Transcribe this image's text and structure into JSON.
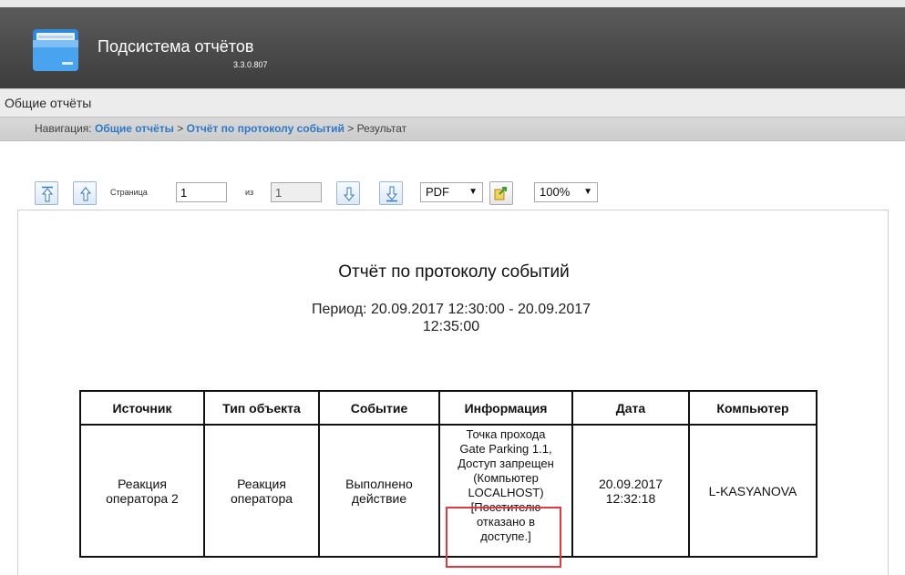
{
  "app": {
    "title": "Подсистема отчётов",
    "version": "3.3.0.807"
  },
  "section": {
    "title": "Общие отчёты"
  },
  "breadcrumb": {
    "prefix": "Навигация:",
    "items": [
      {
        "label": "Общие отчёты"
      },
      {
        "label": "Отчёт по протоколу событий"
      },
      {
        "label": "Результат"
      }
    ],
    "separator": ">"
  },
  "toolbar": {
    "page_label": "Страница",
    "page_value": "1",
    "of_label": "из",
    "total_pages": "1",
    "export_format": "PDF",
    "zoom": "100%"
  },
  "report": {
    "title": "Отчёт по протоколу событий",
    "period_line1": "Период: 20.09.2017 12:30:00 - 20.09.2017",
    "period_line2": "12:35:00",
    "columns": [
      "Источник",
      "Тип объекта",
      "Событие",
      "Информация",
      "Дата",
      "Компьютер"
    ],
    "rows": [
      {
        "source": [
          "Реакция",
          "оператора 2"
        ],
        "object_type": [
          "Реакция",
          "оператора"
        ],
        "event": [
          "Выполнено",
          "действие"
        ],
        "info": [
          "Точка прохода",
          "Gate Parking 1.1,",
          "Доступ запрещен",
          "(Компьютер",
          "LOCALHOST)",
          "[Посетителю",
          "отказано в",
          "доступе.]"
        ],
        "date": [
          "20.09.2017",
          "12:32:18"
        ],
        "computer": "L-KASYANOVA"
      }
    ]
  },
  "colors": {
    "header_bg": "#4a4a4a",
    "link": "#2f79c7",
    "highlight": "#e0393f"
  }
}
